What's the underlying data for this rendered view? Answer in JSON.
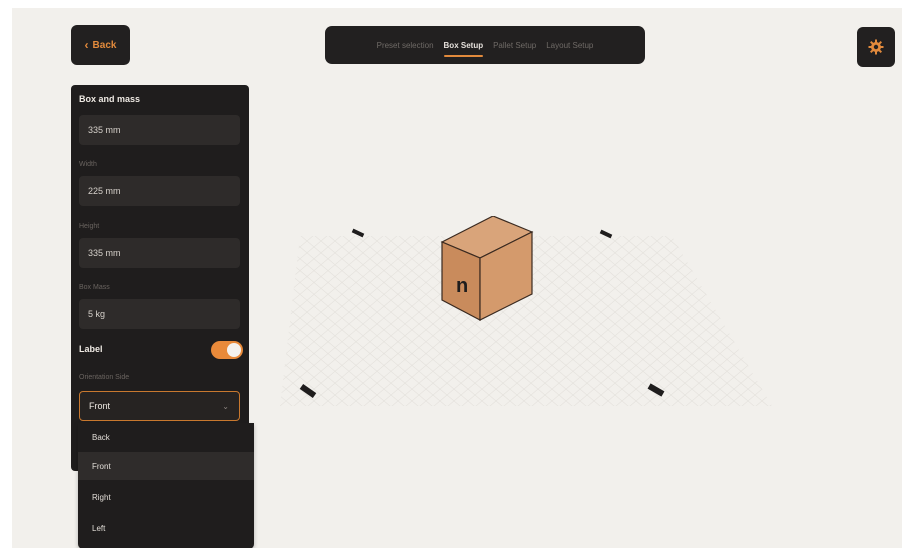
{
  "nav": {
    "back_label": "Back",
    "settings_icon": "gear-icon",
    "steps": [
      {
        "label": "Preset selection",
        "active": false
      },
      {
        "label": "Box Setup",
        "active": true
      },
      {
        "label": "Pallet Setup",
        "active": false
      },
      {
        "label": "Layout Setup",
        "active": false
      }
    ]
  },
  "panel": {
    "title": "Box and mass",
    "fields": [
      {
        "label": "",
        "value": "335 mm"
      },
      {
        "label": "Width",
        "value": "225 mm"
      },
      {
        "label": "Height",
        "value": "335 mm"
      },
      {
        "label": "Box Mass",
        "value": "5 kg"
      }
    ],
    "label_toggle": {
      "label": "Label",
      "on": true
    },
    "orientation": {
      "label": "Orientation Side",
      "selected": "Front",
      "options": [
        "Back",
        "Front",
        "Right",
        "Left"
      ]
    }
  },
  "colors": {
    "accent": "#e28a3c",
    "panel_bg": "#1f1d1d",
    "canvas_bg": "#f2f0ec",
    "box_face": "#c98b5c"
  },
  "box_label_glyph": "n"
}
